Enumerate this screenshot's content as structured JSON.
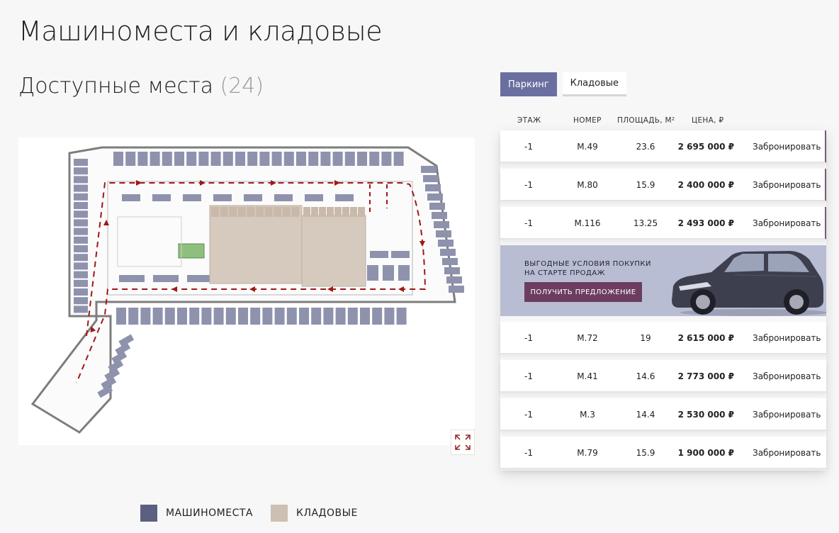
{
  "page": {
    "title": "Машиноместа и кладовые"
  },
  "available": {
    "label": "Доступные места",
    "count": "(24)"
  },
  "tabs": [
    {
      "label": "Паркинг",
      "active": true
    },
    {
      "label": "Кладовые",
      "active": false
    }
  ],
  "table": {
    "headers": {
      "floor": "ЭТАЖ",
      "number": "НОМЕР",
      "area": "ПЛОЩАДЬ, М²",
      "price": "ЦЕНА, ₽"
    },
    "book_label": "Забронировать",
    "rows": [
      {
        "floor": "-1",
        "number": "М.49",
        "area": "23.6",
        "price": "2 695 000 ₽"
      },
      {
        "floor": "-1",
        "number": "М.80",
        "area": "15.9",
        "price": "2 400 000 ₽"
      },
      {
        "floor": "-1",
        "number": "М.116",
        "area": "13.25",
        "price": "2 493 000 ₽"
      },
      {
        "floor": "-1",
        "number": "М.72",
        "area": "19",
        "price": "2 615 000 ₽"
      },
      {
        "floor": "-1",
        "number": "М.41",
        "area": "14.6",
        "price": "2 773 000 ₽"
      },
      {
        "floor": "-1",
        "number": "М.3",
        "area": "14.4",
        "price": "2 530 000 ₽"
      },
      {
        "floor": "-1",
        "number": "М.79",
        "area": "15.9",
        "price": "1 900 000 ₽"
      }
    ]
  },
  "promo": {
    "line1": "ВЫГОДНЫЕ УСЛОВИЯ ПОКУПКИ",
    "line2": "НА СТАРТЕ ПРОДАЖ",
    "button": "ПОЛУЧИТЬ ПРЕДЛОЖЕНИЕ"
  },
  "legend": {
    "parking": {
      "label": "МАШИНОМЕСТА",
      "color": "#5c6080"
    },
    "storage": {
      "label": "КЛАДОВЫЕ",
      "color": "#cdbfb2"
    }
  },
  "colors": {
    "accent": "#6a6fa0",
    "promo_bg": "#b8bdd3",
    "promo_button": "#6c3d60",
    "route": "#a01818",
    "space": "#8e92ad"
  },
  "icons": {
    "expand": "expand-icon"
  }
}
